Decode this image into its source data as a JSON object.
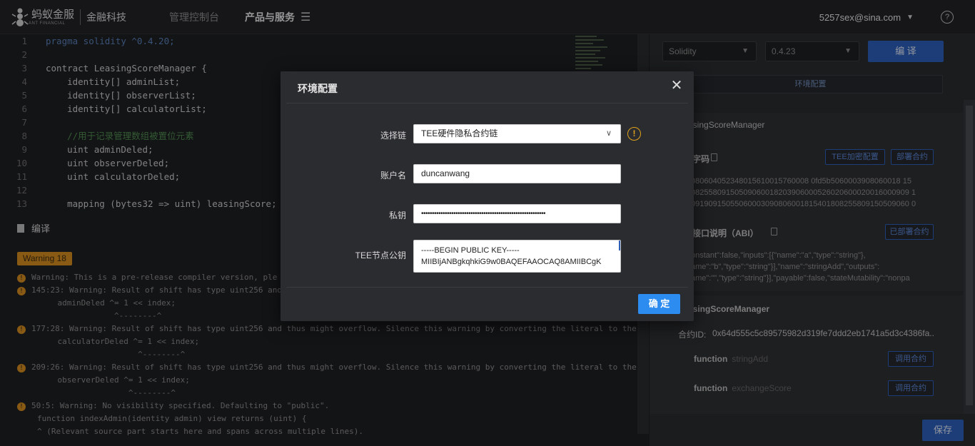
{
  "header": {
    "logo_main": "蚂蚁金服",
    "logo_sub": "ANT FINANCIAL",
    "logo_right": "金融科技",
    "nav": [
      "管理控制台",
      "产品与服务"
    ],
    "user_email": "5257sex@sina.com",
    "help": "?"
  },
  "editor": {
    "lines": [
      {
        "n": "1",
        "text": "pragma solidity ^0.4.20;"
      },
      {
        "n": "2",
        "text": ""
      },
      {
        "n": "3",
        "text": "contract LeasingScoreManager {"
      },
      {
        "n": "4",
        "text": "    identity[] adminList;"
      },
      {
        "n": "5",
        "text": "    identity[] observerList;"
      },
      {
        "n": "6",
        "text": "    identity[] calculatorList;"
      },
      {
        "n": "7",
        "text": ""
      },
      {
        "n": "8",
        "text": "    //用于记录管理数组被置位元素"
      },
      {
        "n": "9",
        "text": "    uint adminDeled;"
      },
      {
        "n": "10",
        "text": "    uint observerDeled;"
      },
      {
        "n": "11",
        "text": "    uint calculatorDeled;"
      },
      {
        "n": "12",
        "text": ""
      },
      {
        "n": "13",
        "text": "    mapping (bytes32 => uint) leasingScore;"
      }
    ]
  },
  "compile": {
    "title": "编译",
    "warning_badge": "Warning 18",
    "log": [
      "Warning: This is a pre-release compiler version, ple",
      "145:23: Warning: Result of shift has type uint256 and",
      "    adminDeled ^= 1 << index;",
      "                ^--------^",
      "177:28: Warning: Result of shift has type uint256 and thus might overflow. Silence this warning by converting the literal to the",
      "    calculatorDeled ^= 1 << index;",
      "                     ^--------^",
      "209:26: Warning: Result of shift has type uint256 and thus might overflow. Silence this warning by converting the literal to the",
      "    observerDeled ^= 1 << index;",
      "                   ^--------^",
      "50:5: Warning: No visibility specified. Defaulting to \"public\".",
      "function indexAdmin(identity admin) view returns (uint) {",
      "^ (Relevant source part starts here and spans across multiple lines)."
    ]
  },
  "right": {
    "language": "Solidity",
    "version": "0.4.23",
    "compile_btn": "编 译",
    "env_btn": "环境配置",
    "contract_title_1": "asingScoreManager",
    "bytecode_label": "字码",
    "tee_btn": "TEE加密配置",
    "deploy_btn": "部署合约",
    "bytecode": "080604052348015610015760008 0fd5b5060003908060018 15\n08255809150509060018203906000526020600020016000909 1\n09190915055060003090806001815401808255809150509060 0",
    "abi_label": "接口说明（ABI）",
    "deployed_btn": "已部署合约",
    "abi": "onstant\":false,\"inputs\":[{\"name\":\"a\",\"type\":\"string\"},\name\":\"b\",\"type\":\"string\"}],\"name\":\"stringAdd\",\"outputs\":\name\":\"\",\"type\":\"string\"}],\"payable\":false,\"stateMutability\":\"nonpa",
    "contract_title_2": "asingScoreManager",
    "contract_id_label": "合约ID:",
    "contract_id": "0x64d555c5c89575982d319fe7ddd2eb1741a5d3c4386fa...",
    "functions": [
      {
        "kw": "function",
        "name": "stringAdd",
        "btn": "调用合约"
      },
      {
        "kw": "function",
        "name": "exchangeScore",
        "btn": "调用合约"
      }
    ],
    "save_btn": "保存"
  },
  "modal": {
    "title": "环境配置",
    "chain_label": "选择链",
    "chain_value": "TEE硬件隐私合约链",
    "account_label": "账户名",
    "account_value": "duncanwang",
    "key_label": "私钥",
    "key_value": "••••••••••••••••••••••••••••••••••••••••••••••••••••••••••",
    "tee_label": "TEE节点公钥",
    "tee_line1": "-----BEGIN PUBLIC KEY-----",
    "tee_line2": "MIIBIjANBgkqhkiG9w0BAQEFAAOCAQ8AMIIBCgK",
    "ok_btn": "确 定"
  }
}
